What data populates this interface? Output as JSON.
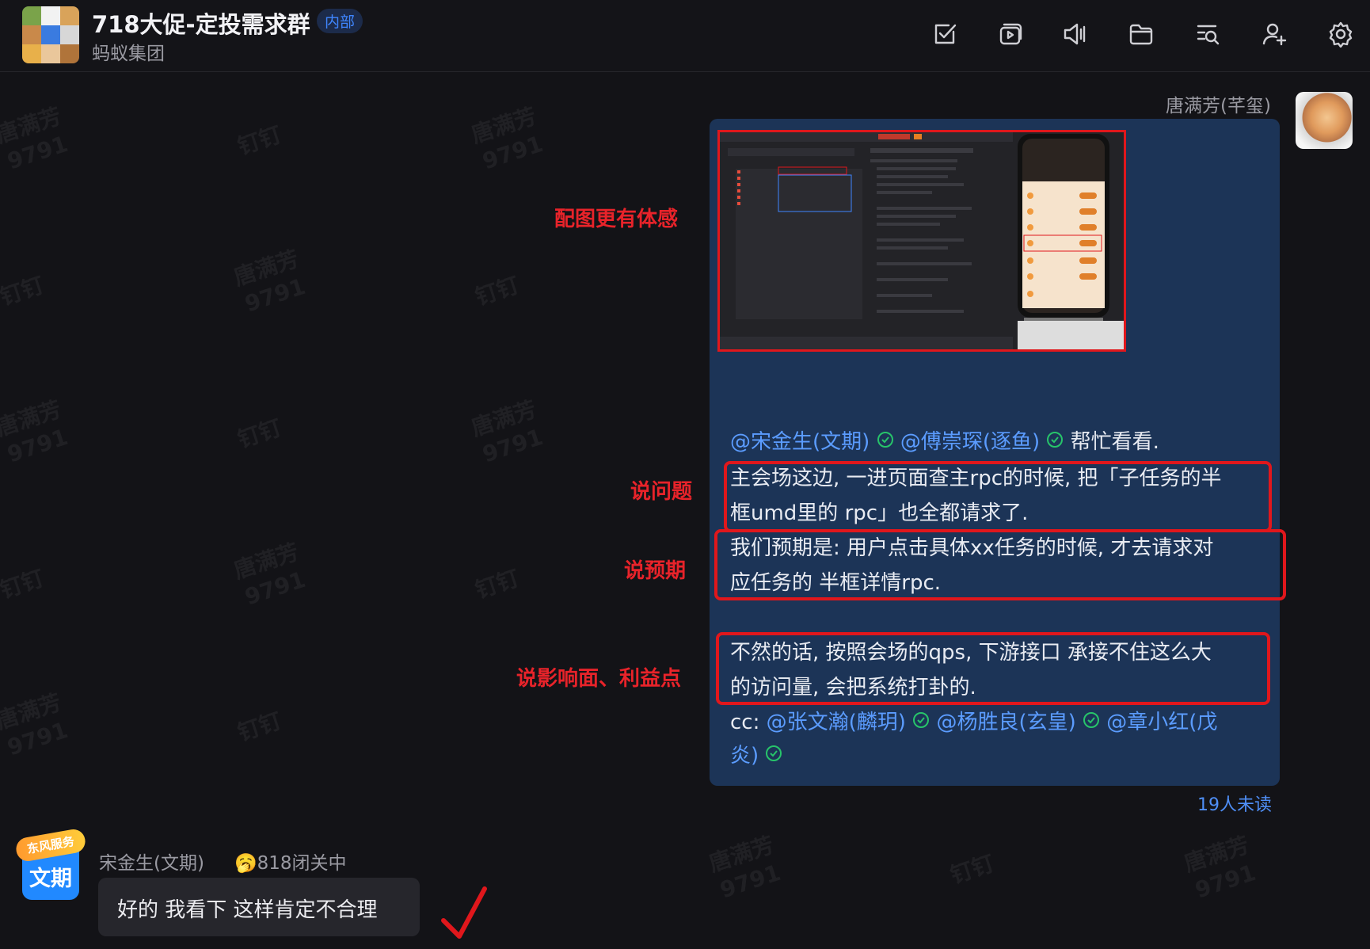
{
  "header": {
    "title": "718大促-定投需求群",
    "badge": "内部",
    "subtitle": "蚂蚁集团",
    "toolbar": [
      "todo-icon",
      "live-icon",
      "announce-icon",
      "files-icon",
      "search-history-icon",
      "add-member-icon",
      "settings-icon"
    ]
  },
  "watermark": {
    "name": "唐满芳",
    "id": "9791",
    "brand": "钉钉"
  },
  "message": {
    "sender": "唐满芳(芊玺)",
    "mentions_line": {
      "m1": "@宋金生(文期)",
      "m2": "@傅崇琛(逐鱼)",
      "text": "帮忙看看."
    },
    "problem": [
      "主会场这边, 一进页面查主rpc的时候, 把「子任务的半",
      "框umd里的 rpc」也全都请求了."
    ],
    "expectation": [
      "我们预期是: 用户点击具体xx任务的时候, 才去请求对",
      "应任务的 半框详情rpc."
    ],
    "impact": [
      "不然的话, 按照会场的qps, 下游接口 承接不住这么大",
      "的访问量, 会把系统打卦的."
    ],
    "cc": {
      "prefix": "cc:",
      "m1": "@张文瀚(麟玥)",
      "m2": "@杨胜良(玄皇)",
      "m3": "@章小红(戊",
      "m3b": "炎)"
    },
    "unread": "19人未读"
  },
  "annotations": {
    "image": "配图更有体感",
    "problem": "说问题",
    "expectation": "说预期",
    "impact": "说影响面、利益点"
  },
  "reply": {
    "avatar_text": "文期",
    "avatar_badge": "东风服务",
    "sender": "宋金生(文期)",
    "status": "🥱818闭关中",
    "text": "好的 我看下 这样肯定不合理"
  },
  "colors": {
    "accent": "#3f86ff",
    "annotation_red": "#e0171c",
    "bubble": "#1c3457",
    "check": "#27c46a"
  }
}
